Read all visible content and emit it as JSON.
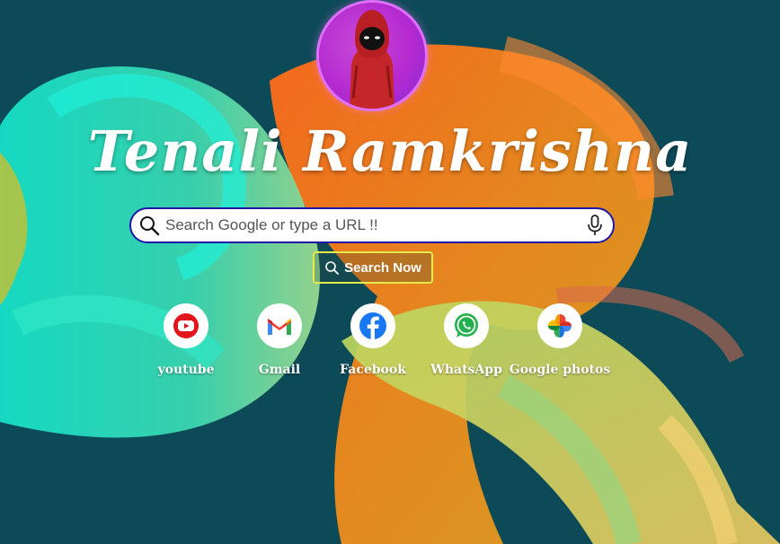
{
  "profile": {
    "name": "Tenali Ramkrishna",
    "avatar_icon": "hooded-figure-avatar"
  },
  "search": {
    "placeholder": "Search Google or type a URL !!",
    "value": "",
    "button_label": "Search Now",
    "border_color": "#1f17a8",
    "button_border_color": "#e6e94a"
  },
  "shortcuts": [
    {
      "label": "youtube",
      "icon": "youtube-icon"
    },
    {
      "label": "Gmail",
      "icon": "gmail-icon"
    },
    {
      "label": "Facebook",
      "icon": "facebook-icon"
    },
    {
      "label": "WhatsApp",
      "icon": "whatsapp-icon"
    },
    {
      "label": "Google photos",
      "icon": "google-photos-icon"
    }
  ]
}
